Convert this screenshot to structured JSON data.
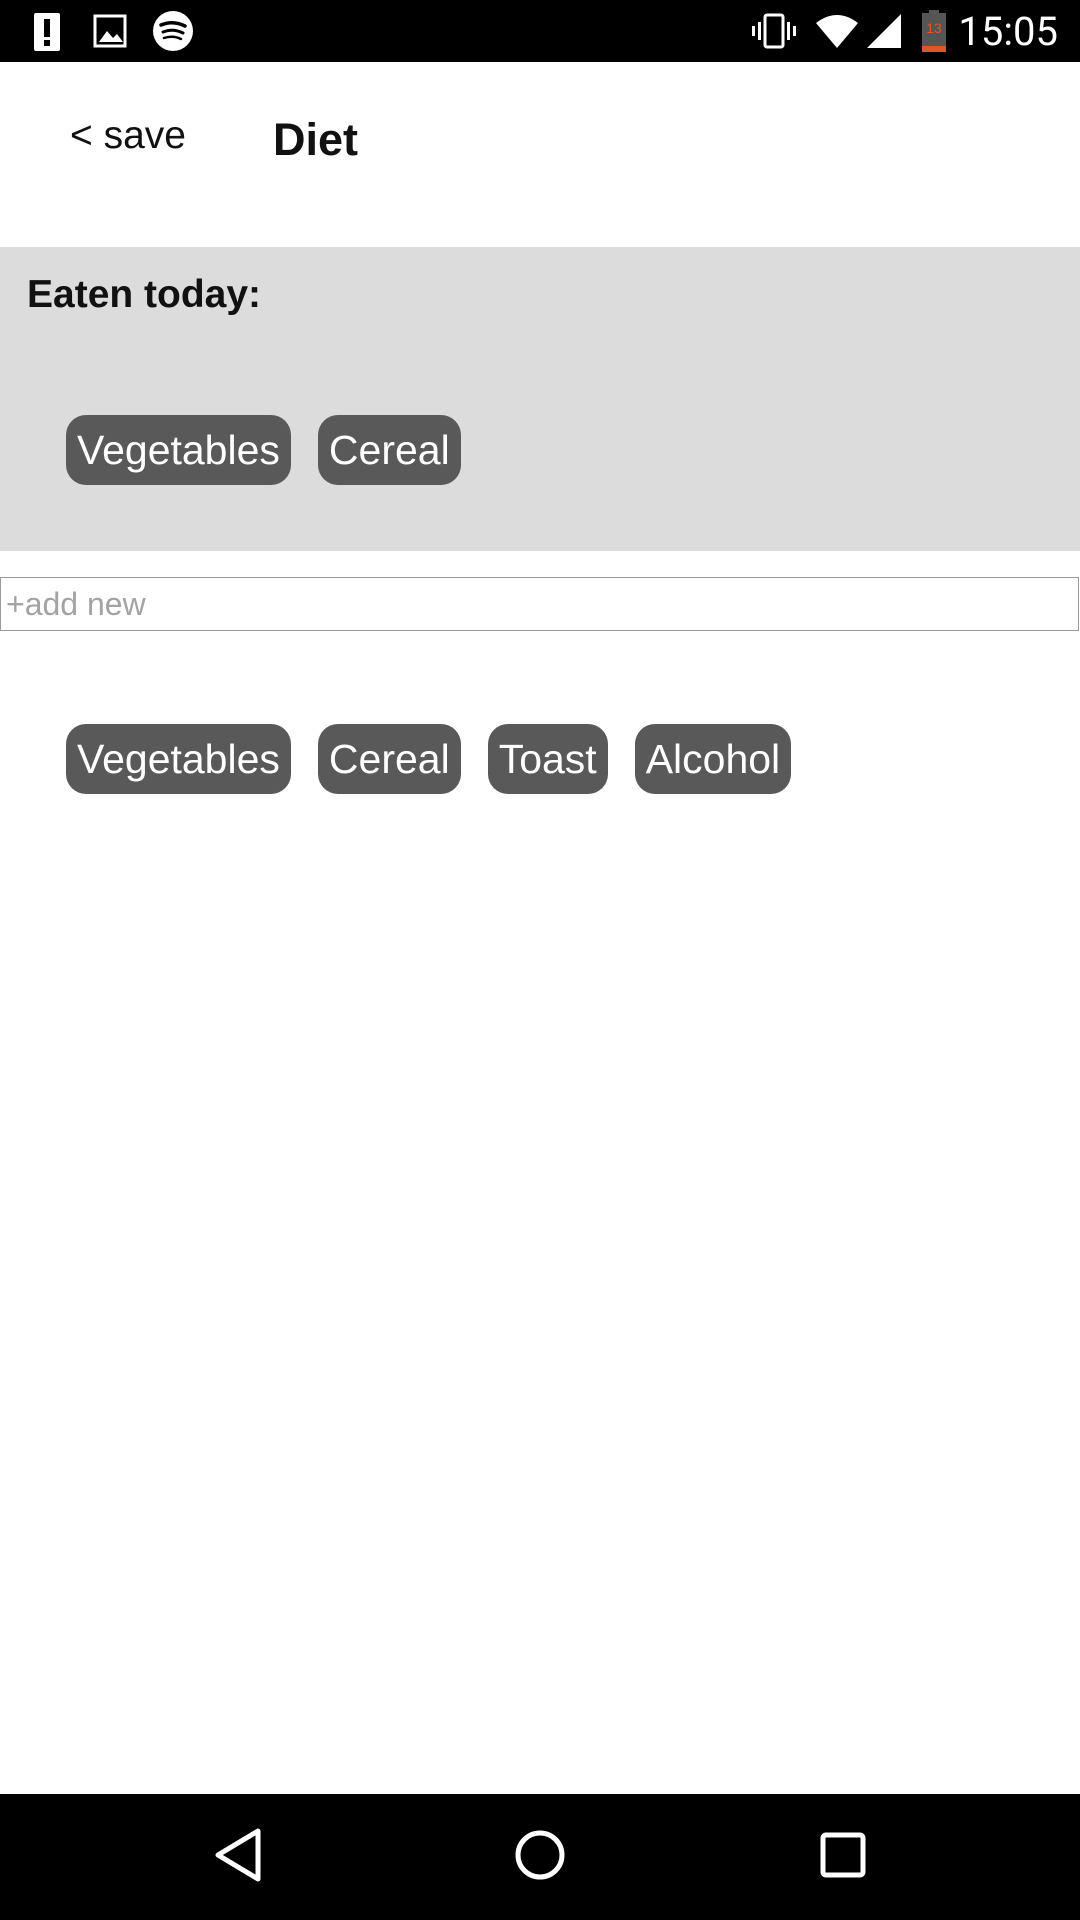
{
  "status_bar": {
    "time": "15:05",
    "battery_level": "13",
    "icons": [
      "alert-icon",
      "image-icon",
      "spotify-icon",
      "vibrate-icon",
      "wifi-icon",
      "signal-icon",
      "battery-icon"
    ]
  },
  "header": {
    "back_label": "< save",
    "title": "Diet"
  },
  "eaten_today": {
    "label": "Eaten today:",
    "items": [
      "Vegetables",
      "Cereal"
    ]
  },
  "add_new": {
    "placeholder": "+add new",
    "value": ""
  },
  "suggestions": {
    "items": [
      "Vegetables",
      "Cereal",
      "Toast",
      "Alcohol"
    ]
  },
  "nav_bar": {
    "buttons": [
      "back-icon",
      "home-icon",
      "recents-icon"
    ]
  },
  "colors": {
    "chip_background": "#595959",
    "panel_background": "#dcdcdc",
    "battery_accent": "#e0562b"
  }
}
